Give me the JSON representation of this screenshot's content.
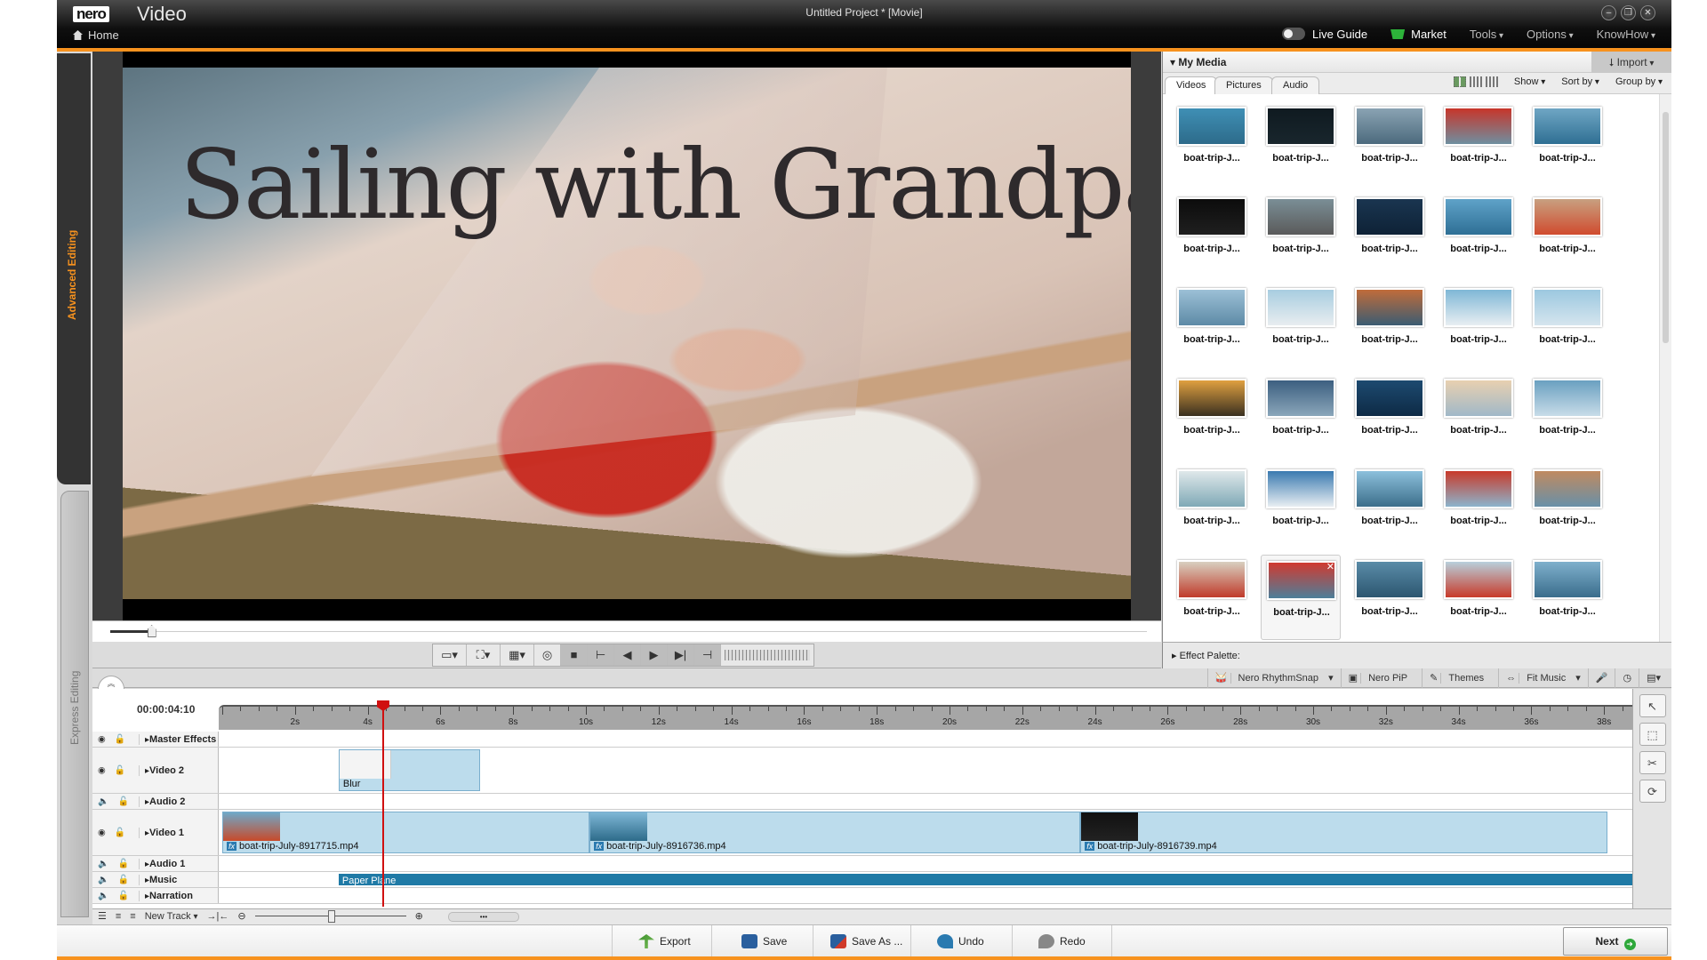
{
  "titlebar": {
    "logo": "nero",
    "app_name": "Video",
    "home": "Home",
    "project_title": "Untitled Project * [Movie]",
    "window_buttons": [
      "minimize",
      "restore",
      "close"
    ],
    "live_guide": "Live Guide",
    "live_guide_on": false,
    "market": "Market",
    "tools": "Tools",
    "options": "Options",
    "knowhow": "KnowHow"
  },
  "side_tabs": {
    "advanced": "Advanced Editing",
    "express": "Express Editing"
  },
  "preview": {
    "overlay_title": "Sailing with Grandpa",
    "position_fraction": 0.04
  },
  "transport": {
    "buttons": [
      "display-mode",
      "fullscreen",
      "aspect",
      "snapshot",
      "stop",
      "mark-in",
      "prev-frame",
      "play",
      "next-frame",
      "mark-out"
    ]
  },
  "media": {
    "title": "My Media",
    "import": "Import",
    "tabs": [
      "Videos",
      "Pictures",
      "Audio"
    ],
    "active_tab": "Videos",
    "show": "Show",
    "sort_by": "Sort by",
    "group_by": "Group by",
    "items": [
      {
        "label": "boat-trip-J...",
        "c1": "#3f8fb5",
        "c2": "#2d6b8a"
      },
      {
        "label": "boat-trip-J...",
        "c1": "#0f1a20",
        "c2": "#19262d"
      },
      {
        "label": "boat-trip-J...",
        "c1": "#8aa3b3",
        "c2": "#4c6a7d"
      },
      {
        "label": "boat-trip-J...",
        "c1": "#c7352a",
        "c2": "#6f8fa0"
      },
      {
        "label": "boat-trip-J...",
        "c1": "#6fa6c4",
        "c2": "#2f6f93"
      },
      {
        "label": "boat-trip-J...",
        "c1": "#0c0c0c",
        "c2": "#1f1f1f"
      },
      {
        "label": "boat-trip-J...",
        "c1": "#7a8e96",
        "c2": "#5a5a5a"
      },
      {
        "label": "boat-trip-J...",
        "c1": "#1a3550",
        "c2": "#0e2236"
      },
      {
        "label": "boat-trip-J...",
        "c1": "#5fa2c8",
        "c2": "#2e6f95"
      },
      {
        "label": "boat-trip-J...",
        "c1": "#c8a080",
        "c2": "#d04b2e"
      },
      {
        "label": "boat-trip-J...",
        "c1": "#9cc0d6",
        "c2": "#5d8aa6"
      },
      {
        "label": "boat-trip-J...",
        "c1": "#a8cde0",
        "c2": "#e8edf0"
      },
      {
        "label": "boat-trip-J...",
        "c1": "#c06c3a",
        "c2": "#3b5c72"
      },
      {
        "label": "boat-trip-J...",
        "c1": "#7fb7d6",
        "c2": "#e8eef2"
      },
      {
        "label": "boat-trip-J...",
        "c1": "#9cc8e0",
        "c2": "#d5e5ee"
      },
      {
        "label": "boat-trip-J...",
        "c1": "#e0a040",
        "c2": "#3a3020"
      },
      {
        "label": "boat-trip-J...",
        "c1": "#3c5f80",
        "c2": "#8aa6ba"
      },
      {
        "label": "boat-trip-J...",
        "c1": "#1d4a70",
        "c2": "#0d2a45"
      },
      {
        "label": "boat-trip-J...",
        "c1": "#e8d0b0",
        "c2": "#a0b8c8"
      },
      {
        "label": "boat-trip-J...",
        "c1": "#6aa0c0",
        "c2": "#c8dce8"
      },
      {
        "label": "boat-trip-J...",
        "c1": "#dfe8ea",
        "c2": "#7fa9b6"
      },
      {
        "label": "boat-trip-J...",
        "c1": "#3a7ab0",
        "c2": "#e8eef2"
      },
      {
        "label": "boat-trip-J...",
        "c1": "#8cc0dc",
        "c2": "#3c6e8a"
      },
      {
        "label": "boat-trip-J...",
        "c1": "#c83a2a",
        "c2": "#8cb4cc"
      },
      {
        "label": "boat-trip-J...",
        "c1": "#c08a60",
        "c2": "#6890a8"
      },
      {
        "label": "boat-trip-J...",
        "c1": "#d8d0c0",
        "c2": "#c03a2a"
      },
      {
        "label": "boat-trip-J...",
        "c1": "#d03a30",
        "c2": "#4d7f9a",
        "selected": true
      },
      {
        "label": "boat-trip-J...",
        "c1": "#5a8ca8",
        "c2": "#2c5670"
      },
      {
        "label": "boat-trip-J...",
        "c1": "#b8d0dc",
        "c2": "#c83a2a"
      },
      {
        "label": "boat-trip-J...",
        "c1": "#7fb0cc",
        "c2": "#3a6d8c"
      }
    ]
  },
  "effect_palette": "Effect Palette:",
  "timeline_tools": [
    "Nero RhythmSnap",
    "Nero PiP",
    "Themes",
    "Fit Music"
  ],
  "timeline": {
    "timecode": "00:00:04:10",
    "playhead_seconds": 4.4,
    "ruler_labels": [
      "2s",
      "4s",
      "6s",
      "8s",
      "10s",
      "12s",
      "14s",
      "16s",
      "18s",
      "20s",
      "22s",
      "24s",
      "26s",
      "28s",
      "30s",
      "32s",
      "34s",
      "36s",
      "38s"
    ],
    "tracks": [
      {
        "name": "Master Effects",
        "kind": "fx"
      },
      {
        "name": "Video 2",
        "kind": "video"
      },
      {
        "name": "Audio 2",
        "kind": "audio"
      },
      {
        "name": "Video 1",
        "kind": "video"
      },
      {
        "name": "Audio 1",
        "kind": "audio"
      },
      {
        "name": "Music",
        "kind": "audio"
      },
      {
        "name": "Narration",
        "kind": "audio"
      }
    ],
    "video2_clip": {
      "label": "Blur",
      "start_s": 3.2,
      "end_s": 7.1
    },
    "video1_clips": [
      {
        "label": "boat-trip-July-8917715.mp4",
        "start_s": 0,
        "end_s": 10.1
      },
      {
        "label": "boat-trip-July-8916736.mp4",
        "start_s": 10.1,
        "end_s": 23.6
      },
      {
        "label": "boat-trip-July-8916739.mp4",
        "start_s": 23.6,
        "end_s": 38.1
      }
    ],
    "music_clip": {
      "label": "Paper Plane",
      "start_s": 3.2,
      "end_s": 39.0
    },
    "new_track": "New Track"
  },
  "actions": {
    "export": "Export",
    "save": "Save",
    "save_as": "Save As ...",
    "undo": "Undo",
    "redo": "Redo",
    "next": "Next"
  },
  "colors": {
    "accent": "#f7921e",
    "clip": "#bcdcec",
    "music": "#1f7aa6",
    "playhead": "#d01010"
  }
}
